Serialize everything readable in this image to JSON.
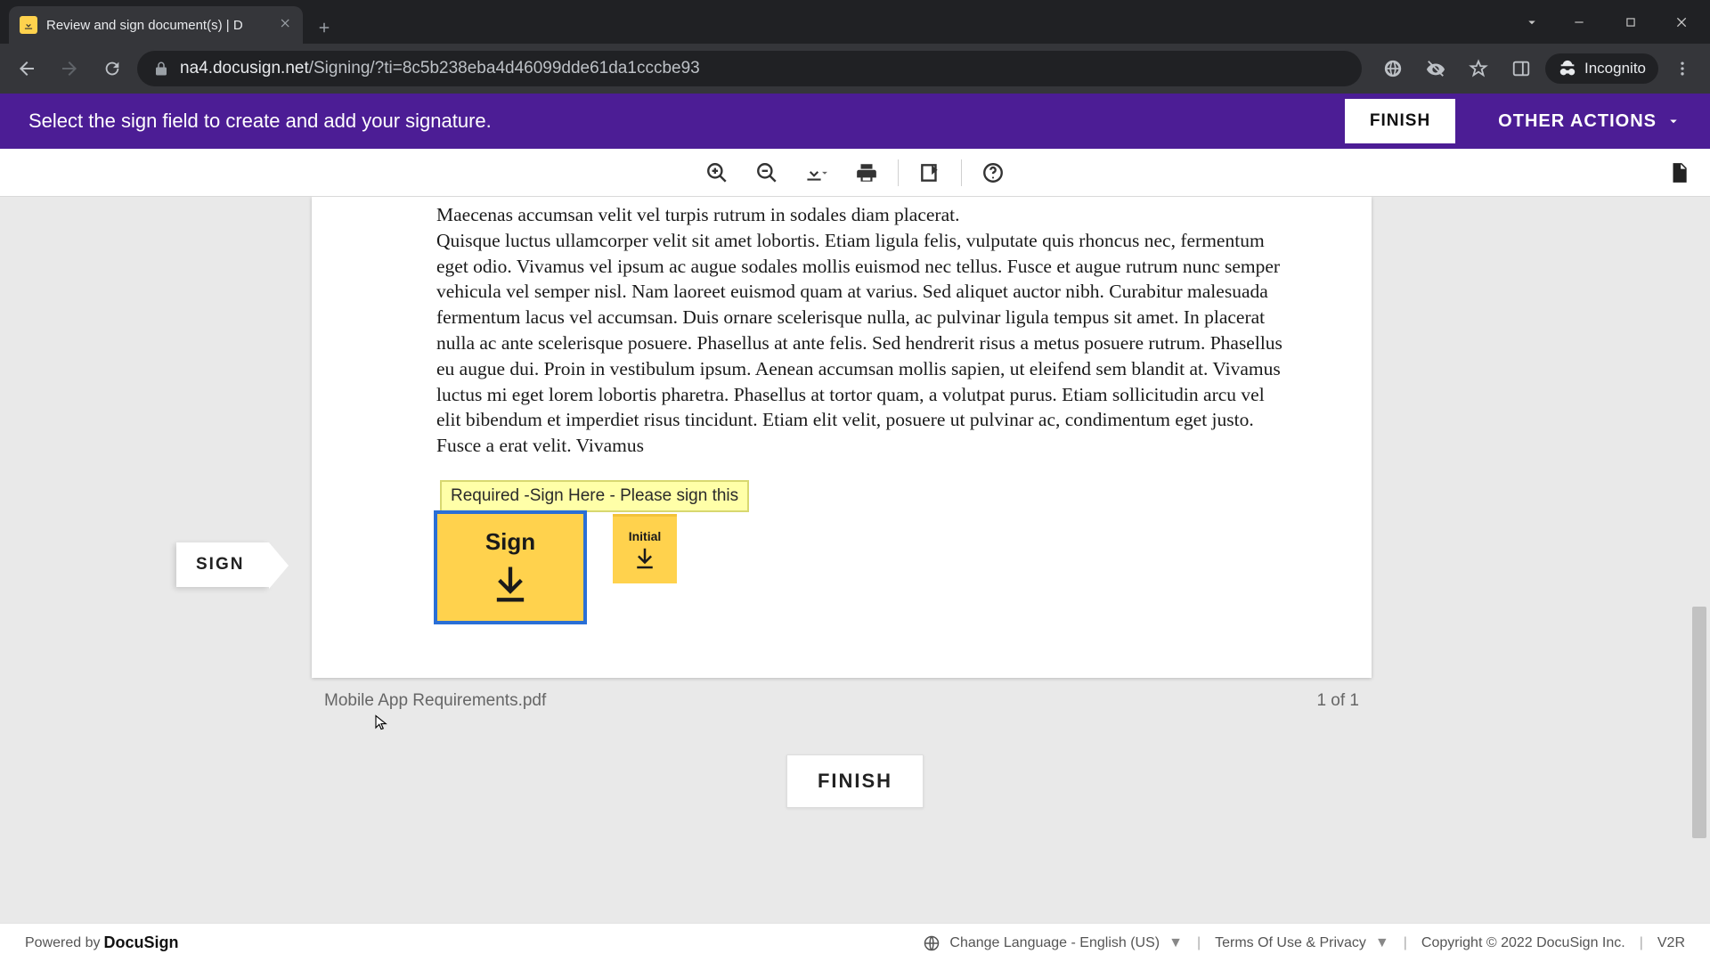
{
  "browser": {
    "tab_title": "Review and sign document(s) | D",
    "url_domain": "na4.docusign.net",
    "url_path": "/Signing/?ti=8c5b238eba4d46099dde61da1cccbe93",
    "incognito_label": "Incognito"
  },
  "dsbar": {
    "message": "Select the sign field to create and add your signature.",
    "finish": "FINISH",
    "other_actions": "OTHER ACTIONS"
  },
  "sign_flag": "SIGN",
  "document": {
    "body_text": "Maecenas accumsan velit vel turpis rutrum in sodales diam placerat.\nQuisque luctus ullamcorper velit sit amet lobortis. Etiam ligula felis, vulputate quis rhoncus nec, fermentum eget odio. Vivamus vel ipsum ac augue sodales mollis euismod nec tellus. Fusce et augue rutrum nunc semper vehicula vel semper nisl. Nam laoreet euismod quam at varius. Sed aliquet auctor nibh. Curabitur malesuada fermentum lacus vel accumsan. Duis ornare scelerisque nulla, ac pulvinar ligula tempus sit amet. In placerat nulla ac ante scelerisque posuere. Phasellus at ante felis. Sed hendrerit risus a metus posuere rutrum. Phasellus eu augue dui. Proin in vestibulum ipsum. Aenean accumsan mollis sapien, ut eleifend sem blandit at. Vivamus luctus mi eget lorem lobortis pharetra. Phasellus at tortor quam, a volutpat purus. Etiam sollicitudin arcu vel elit bibendum et imperdiet risus tincidunt. Etiam elit velit, posuere ut pulvinar ac, condimentum eget justo. Fusce a erat velit. Vivamus",
    "tooltip": "Required -Sign Here - Please sign this",
    "sign_label": "Sign",
    "initial_label": "Initial",
    "file_name": "Mobile App Requirements.pdf",
    "page_count": "1 of 1"
  },
  "bottom_finish": "FINISH",
  "footer": {
    "powered_by": "Powered by",
    "brand": "DocuSign",
    "change_language": "Change Language - English (US)",
    "terms": "Terms Of Use & Privacy",
    "copyright": "Copyright © 2022 DocuSign Inc.",
    "version": "V2R"
  }
}
